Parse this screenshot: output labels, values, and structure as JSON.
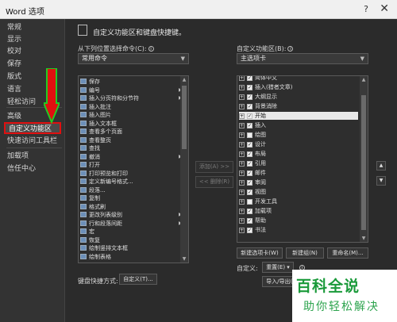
{
  "window": {
    "title": "Word 选项",
    "help": "?",
    "close": "✕"
  },
  "nav": {
    "items": [
      "常规",
      "显示",
      "校对",
      "保存",
      "版式",
      "语言",
      "轻松访问",
      "高级",
      "自定义功能区",
      "快速访问工具栏",
      "加载项",
      "信任中心"
    ],
    "selected_index": 8
  },
  "main": {
    "heading": "自定义功能区和键盘快捷键。",
    "choose_label": "从下列位置选择命令(C):",
    "choose_value": "常用命令",
    "customize_label": "自定义功能区(B):",
    "customize_value": "主选项卡",
    "add_button": "添加(A) >>",
    "remove_button": "<< 删除(R)",
    "commands": [
      {
        "label": "保存",
        "arrow": ""
      },
      {
        "label": "编号",
        "arrow": "▶"
      },
      {
        "label": "插入分页符和分节符",
        "arrow": "▶"
      },
      {
        "label": "插入批注",
        "arrow": ""
      },
      {
        "label": "插入图片",
        "arrow": ""
      },
      {
        "label": "插入文本框",
        "arrow": ""
      },
      {
        "label": "查看多个页面",
        "arrow": ""
      },
      {
        "label": "查看整页",
        "arrow": ""
      },
      {
        "label": "查找",
        "arrow": ""
      },
      {
        "label": "撤消",
        "arrow": "▶"
      },
      {
        "label": "打开",
        "arrow": ""
      },
      {
        "label": "打印预览和打印",
        "arrow": ""
      },
      {
        "label": "定义新编号格式...",
        "arrow": ""
      },
      {
        "label": "段落...",
        "arrow": ""
      },
      {
        "label": "复制",
        "arrow": ""
      },
      {
        "label": "格式刷",
        "arrow": ""
      },
      {
        "label": "更改列表级别",
        "arrow": "▶"
      },
      {
        "label": "行和段落间距",
        "arrow": "▶"
      },
      {
        "label": "宏",
        "arrow": ""
      },
      {
        "label": "恢复",
        "arrow": ""
      },
      {
        "label": "绘制竖排文本框",
        "arrow": ""
      },
      {
        "label": "绘制表格",
        "arrow": ""
      }
    ],
    "tabs": [
      {
        "label": "简体中文",
        "checked": true
      },
      {
        "label": "插入(猎者文章)",
        "checked": true
      },
      {
        "label": "大纲显示",
        "checked": true
      },
      {
        "label": "背景消除",
        "checked": true
      },
      {
        "label": "开始",
        "checked": true
      },
      {
        "label": "插入",
        "checked": true
      },
      {
        "label": "绘图",
        "checked": false
      },
      {
        "label": "设计",
        "checked": true
      },
      {
        "label": "布局",
        "checked": true
      },
      {
        "label": "引用",
        "checked": true
      },
      {
        "label": "邮件",
        "checked": true
      },
      {
        "label": "审阅",
        "checked": true
      },
      {
        "label": "视图",
        "checked": true
      },
      {
        "label": "开发工具",
        "checked": false
      },
      {
        "label": "加载项",
        "checked": true
      },
      {
        "label": "帮助",
        "checked": true
      },
      {
        "label": "书法",
        "checked": true
      }
    ],
    "new_tab_button": "新建选项卡(W)",
    "new_group_button": "新建组(N)",
    "rename_button": "重命名(M)...",
    "customize_small_label": "自定义:",
    "reset_button": "重置(E) ▾",
    "import_export_button": "导入/导出(P) ▾",
    "keyboard_label": "键盘快捷方式:",
    "keyboard_button": "自定义(T)...",
    "cancel_button": "取消"
  },
  "watermark": {
    "logo": "百科全说",
    "sub": "助你轻松解决"
  }
}
